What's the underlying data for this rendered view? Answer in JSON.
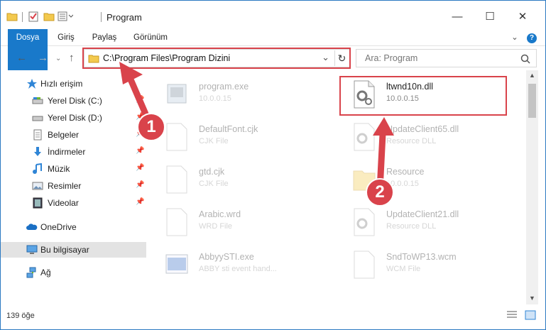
{
  "window": {
    "title": "Program",
    "minimize": "—",
    "maximize": "☐",
    "close": "✕"
  },
  "ribbon": {
    "tabs": [
      "Dosya",
      "Giriş",
      "Paylaş",
      "Görünüm"
    ],
    "expand": "⌄",
    "help": "?"
  },
  "address": {
    "path": "C:\\Program Files\\Program Dizini",
    "dropdown": "⌄",
    "refresh": "↻"
  },
  "search": {
    "placeholder": "Ara: Program",
    "icon": "search-icon"
  },
  "nav": {
    "back": "←",
    "forward": "→",
    "up": "↑",
    "items": [
      {
        "label": "Hızlı erişim",
        "icon": "star-icon",
        "pinned": false
      },
      {
        "label": "Yerel Disk (C:)",
        "icon": "drive-icon",
        "pinned": true
      },
      {
        "label": "Yerel Disk (D:)",
        "icon": "drive-icon",
        "pinned": true
      },
      {
        "label": "Belgeler",
        "icon": "documents-icon",
        "pinned": true
      },
      {
        "label": "İndirmeler",
        "icon": "download-icon",
        "pinned": true
      },
      {
        "label": "Müzik",
        "icon": "music-icon",
        "pinned": true
      },
      {
        "label": "Resimler",
        "icon": "pictures-icon",
        "pinned": true
      },
      {
        "label": "Videolar",
        "icon": "video-icon",
        "pinned": true
      },
      {
        "label": "OneDrive",
        "icon": "cloud-icon",
        "pinned": false
      },
      {
        "label": "Bu bilgisayar",
        "icon": "computer-icon",
        "pinned": false
      },
      {
        "label": "Ağ",
        "icon": "network-icon",
        "pinned": false
      }
    ]
  },
  "files": [
    {
      "name": "program.exe",
      "sub": "10.0.0.15",
      "icon": "exe-icon"
    },
    {
      "name": "ltwnd10n.dll",
      "sub": "10.0.0.15",
      "icon": "dll-icon"
    },
    {
      "name": "DefaultFont.cjk",
      "sub": "CJK File",
      "icon": "file-icon"
    },
    {
      "name": "UpdateClient65.dll",
      "sub": "Resource DLL",
      "icon": "dll-icon"
    },
    {
      "name": "gtd.cjk",
      "sub": "CJK File",
      "icon": "file-icon"
    },
    {
      "name": "Resource",
      "sub": "10.0.0.15",
      "icon": "folder-icon"
    },
    {
      "name": "Arabic.wrd",
      "sub": "WRD File",
      "icon": "file-icon"
    },
    {
      "name": "UpdateClient21.dll",
      "sub": "Resource DLL",
      "icon": "dll-icon"
    },
    {
      "name": "AbbyySTI.exe",
      "sub": "ABBY sti event hand...",
      "icon": "exe-icon"
    },
    {
      "name": "SndToWP13.wcm",
      "sub": "WCM File",
      "icon": "file-icon"
    }
  ],
  "status": {
    "count": "139 öğe"
  },
  "annotations": {
    "step1": "1",
    "step2": "2"
  },
  "colors": {
    "accent": "#1979ca",
    "highlight": "#d9434b"
  }
}
